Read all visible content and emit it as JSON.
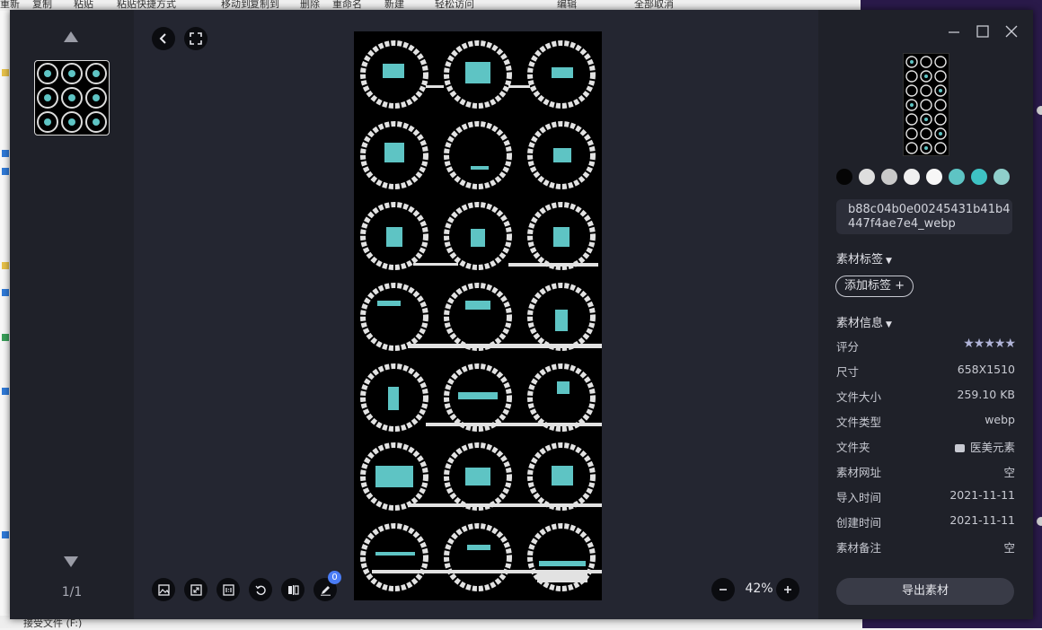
{
  "background": {
    "top_fragments": [
      "重新",
      "复制",
      "粘贴",
      "粘贴快捷方式",
      "移动到",
      "复制到",
      "删除",
      "重命名",
      "新建",
      "轻松访问",
      "编辑",
      "全部取消"
    ],
    "bottom_drive": "接受文件 (F:)"
  },
  "viewer": {
    "page_count": "1/1",
    "zoom": "42%",
    "annotate_badge": "0"
  },
  "panel": {
    "swatches": [
      "#050505",
      "#dedede",
      "#c9c9c9",
      "#f0f0f0",
      "#f7f7f7",
      "#5ec4c4",
      "#3ec3c4",
      "#8fcfcb"
    ],
    "filename": "b88c04b0e00245431b41b4447f4ae7e4_webp",
    "tags_title": "素材标签",
    "add_tag": "添加标签 +",
    "info_title": "素材信息",
    "info": [
      {
        "key": "评分",
        "value": "★★★★★",
        "rating": 5
      },
      {
        "key": "尺寸",
        "value": "658X1510"
      },
      {
        "key": "文件大小",
        "value": "259.10 KB"
      },
      {
        "key": "文件类型",
        "value": "webp"
      },
      {
        "key": "文件夹",
        "value": "医美元素"
      },
      {
        "key": "素材网址",
        "value": "空"
      },
      {
        "key": "导入时间",
        "value": "2021-11-11"
      },
      {
        "key": "创建时间",
        "value": "2021-11-11"
      },
      {
        "key": "素材备注",
        "value": "空"
      }
    ],
    "export": "导出素材"
  }
}
